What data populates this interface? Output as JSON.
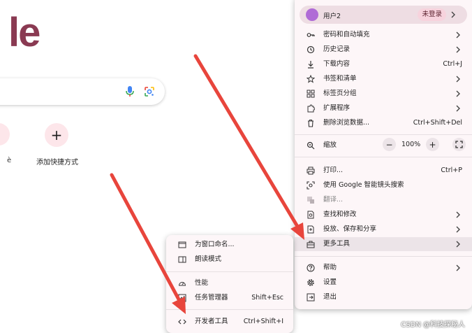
{
  "page": {
    "logo_fragment": "le",
    "shortcut_partial_label": "è",
    "add_shortcut_label": "添加快捷方式"
  },
  "main_menu": {
    "profile": {
      "name": "用户2",
      "status": "未登录"
    },
    "items": [
      {
        "label": "密码和自动填充",
        "shortcut": ""
      },
      {
        "label": "历史记录",
        "shortcut": ""
      },
      {
        "label": "下载内容",
        "shortcut": "Ctrl+J"
      },
      {
        "label": "书签和清单",
        "shortcut": ""
      },
      {
        "label": "标签页分组",
        "shortcut": ""
      },
      {
        "label": "扩展程序",
        "shortcut": ""
      },
      {
        "label": "删除浏览数据...",
        "shortcut": "Ctrl+Shift+Del"
      }
    ],
    "zoom": {
      "label": "缩放",
      "minus": "−",
      "value": "100%",
      "plus": "+"
    },
    "items2": [
      {
        "label": "打印...",
        "shortcut": "Ctrl+P"
      },
      {
        "label": "使用 Google 智能镜头搜索",
        "shortcut": ""
      },
      {
        "label": "翻译...",
        "shortcut": ""
      },
      {
        "label": "查找和修改",
        "shortcut": ""
      },
      {
        "label": "投放、保存和分享",
        "shortcut": ""
      },
      {
        "label": "更多工具",
        "shortcut": ""
      }
    ],
    "items3": [
      {
        "label": "帮助"
      },
      {
        "label": "设置"
      },
      {
        "label": "退出"
      }
    ]
  },
  "sub_menu": {
    "items": [
      {
        "label": "为窗口命名...",
        "shortcut": ""
      },
      {
        "label": "朗读模式",
        "shortcut": ""
      },
      {
        "label": "性能",
        "shortcut": ""
      },
      {
        "label": "任务管理器",
        "shortcut": "Shift+Esc"
      },
      {
        "label": "开发者工具",
        "shortcut": "Ctrl+Shift+I"
      }
    ]
  },
  "watermark": "CSDN @科技探秘人",
  "colors": {
    "arrow": "#e8453c",
    "logo": "#8a3a52",
    "menu_bg": "#fdf6f8",
    "highlight": "#ece4e8"
  },
  "icons": {
    "mic": "mic-icon",
    "lens": "lens-icon",
    "add": "plus-icon",
    "key": "key-icon",
    "history": "history-icon",
    "download": "download-icon",
    "star": "star-icon",
    "tab-groups": "tab-groups-icon",
    "puzzle": "puzzle-icon",
    "trash": "trash-icon",
    "zoom": "zoom-icon",
    "print": "print-icon",
    "google-lens": "google-lens-icon",
    "translate": "translate-icon",
    "find": "find-icon",
    "cast": "cast-icon",
    "toolbox": "toolbox-icon",
    "help": "help-icon",
    "settings": "gear-icon",
    "exit": "exit-icon"
  }
}
